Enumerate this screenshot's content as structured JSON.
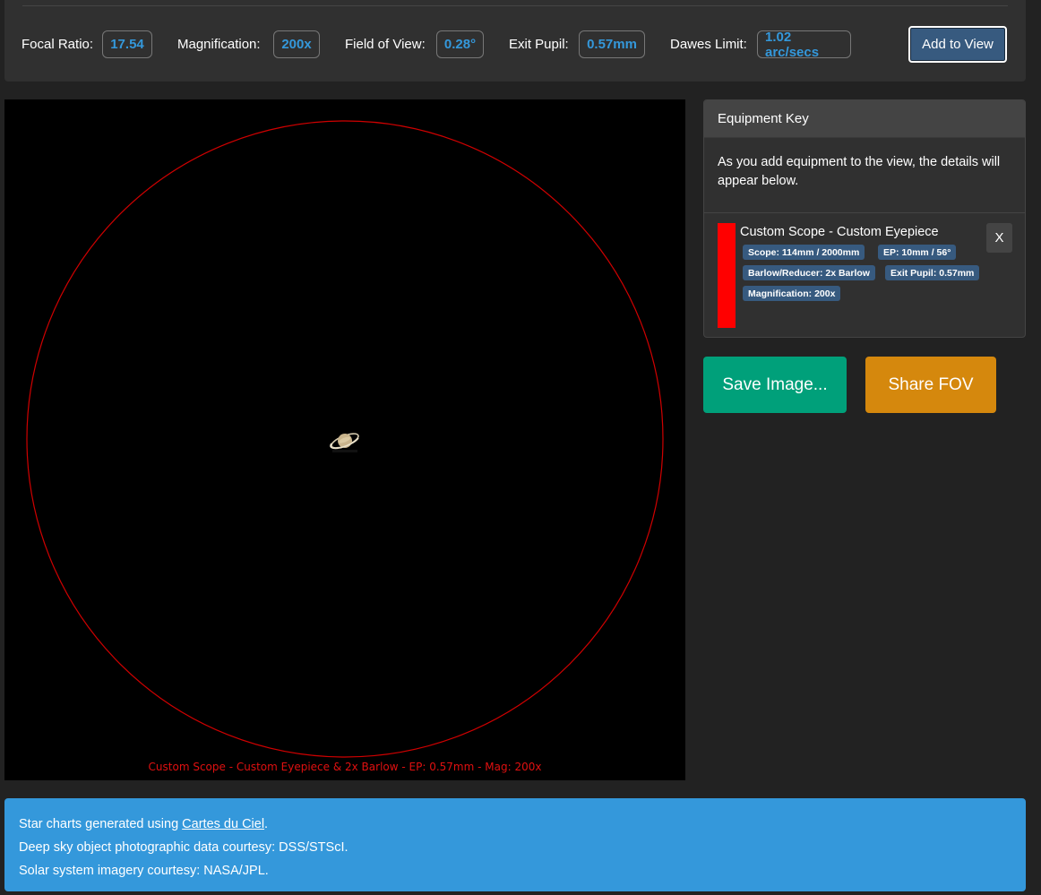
{
  "stats": {
    "focal_ratio": {
      "label": "Focal Ratio:",
      "value": "17.54"
    },
    "magnification": {
      "label": "Magnification:",
      "value": "200x"
    },
    "field_of_view": {
      "label": "Field of View:",
      "value": "0.28°"
    },
    "exit_pupil": {
      "label": "Exit Pupil:",
      "value": "0.57mm"
    },
    "dawes_limit": {
      "label": "Dawes Limit:",
      "value": "1.02 arc/secs"
    },
    "add_button": "Add to View"
  },
  "fov": {
    "caption": "Custom Scope - Custom Eyepiece & 2x Barlow - EP: 0.57mm - Mag: 200x",
    "circle_color": "#ff0000",
    "object_icon": "saturn-icon"
  },
  "equipment_key": {
    "header": "Equipment Key",
    "description": "As you add equipment to the view, the details will appear below.",
    "entries": [
      {
        "color": "#ff0000",
        "title": "Custom Scope - Custom Eyepiece",
        "badges": {
          "scope": "Scope: 114mm / 2000mm",
          "eyepiece": "EP: 10mm / 56°",
          "barlow": "Barlow/Reducer: 2x Barlow",
          "exit_pupil": "Exit Pupil: 0.57mm",
          "magnification": "Magnification: 200x"
        },
        "remove_label": "X"
      }
    ]
  },
  "actions": {
    "save_label": "Save Image...",
    "share_label": "Share FOV"
  },
  "credits": {
    "line1_prefix": "Star charts generated using ",
    "line1_link": "Cartes du Ciel",
    "line1_suffix": ".",
    "line2": "Deep sky object photographic data courtesy: DSS/STScI.",
    "line3": "Solar system imagery courtesy: NASA/JPL."
  }
}
